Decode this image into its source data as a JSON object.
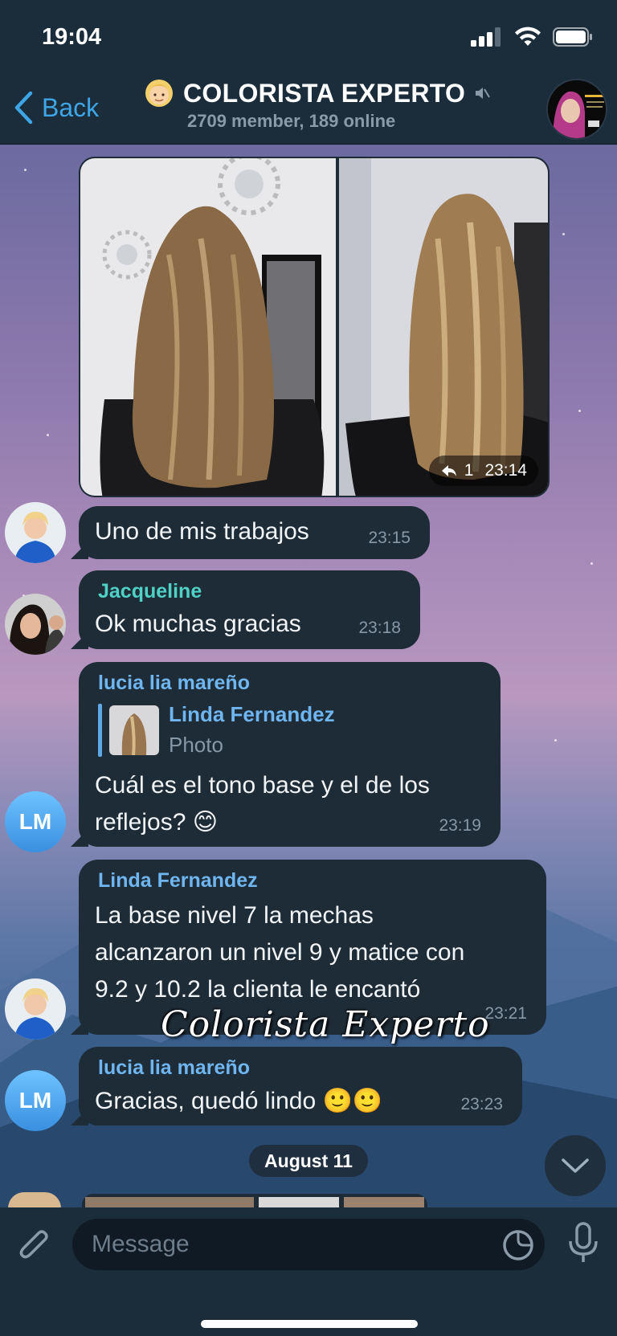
{
  "status_bar": {
    "time": "19:04"
  },
  "header": {
    "back_label": "Back",
    "title": "COLORISTA EXPERTO",
    "subtitle": "2709 member, 189 online",
    "avatar_logo_text": "COLORISTA"
  },
  "messages": [
    {
      "type": "album",
      "forwards": "1",
      "time": "23:14"
    },
    {
      "type": "text",
      "text": "Uno de mis trabajos",
      "time": "23:15"
    },
    {
      "type": "text",
      "sender": "Jacqueline",
      "text": "Ok muchas gracias",
      "time": "23:18"
    },
    {
      "type": "reply",
      "sender": "lucia lia mareño",
      "avatar_initials": "LM",
      "reply_to_name": "Linda Fernandez",
      "reply_to_text": "Photo",
      "text_line1": "Cuál es el tono base y el de los",
      "text_line2": "reflejos? 😊",
      "time": "23:19"
    },
    {
      "type": "text",
      "sender": "Linda Fernandez",
      "text_line1": "La base nivel 7 la mechas",
      "text_line2": "alcanzaron un nivel 9 y matice con",
      "text_line3": "9.2 y 10.2 la clienta le encantó",
      "time": "23:21"
    },
    {
      "type": "text",
      "sender": "lucia lia mareño",
      "avatar_initials": "LM",
      "text": "Gracias, quedó lindo 🙂🙂",
      "time": "23:23"
    }
  ],
  "date_separator": "August 11",
  "watermark": "Colorista Experto",
  "composer": {
    "placeholder": "Message"
  },
  "colors": {
    "accent": "#3ea6e6",
    "bubble": "#1e2c38",
    "name_teal": "#4fd1c5",
    "name_blue": "#6fb6f0"
  }
}
